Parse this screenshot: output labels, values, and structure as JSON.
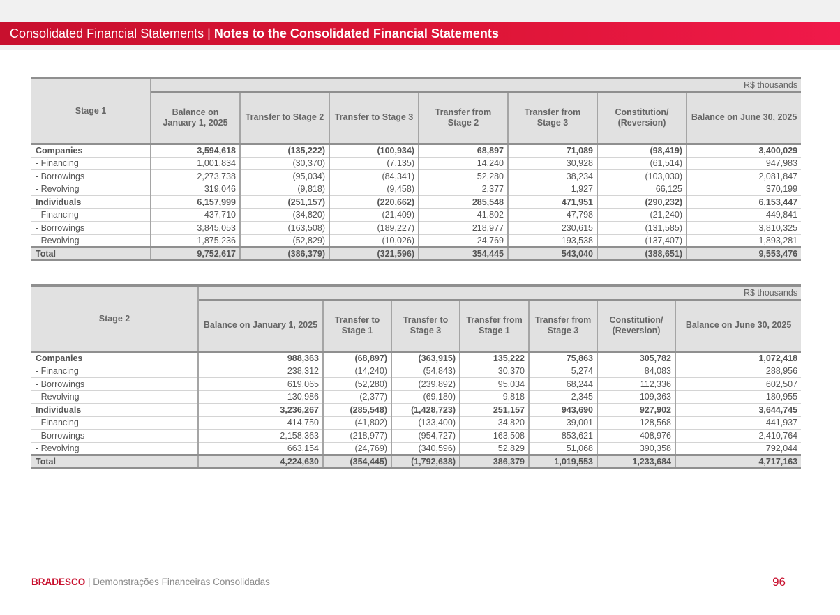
{
  "header": {
    "section": "Consolidated Financial Statements",
    "separator": " | ",
    "subsection": "Notes to the Consolidated Financial Statements"
  },
  "table1": {
    "corner": "Stage 1",
    "unit": "R$ thousands",
    "columns": [
      "Balance on January 1, 2025",
      "Transfer to Stage 2",
      "Transfer to Stage 3",
      "Transfer from Stage 2",
      "Transfer from Stage 3",
      "Constitution/ (Reversion)",
      "Balance on June 30, 2025"
    ],
    "rows": [
      {
        "label": "Companies",
        "values": [
          "3,594,618",
          "(135,222)",
          "(100,934)",
          "68,897",
          "71,089",
          "(98,419)",
          "3,400,029"
        ]
      },
      {
        "label": "- Financing",
        "values": [
          "1,001,834",
          "(30,370)",
          "(7,135)",
          "14,240",
          "30,928",
          "(61,514)",
          "947,983"
        ]
      },
      {
        "label": "- Borrowings",
        "values": [
          "2,273,738",
          "(95,034)",
          "(84,341)",
          "52,280",
          "38,234",
          "(103,030)",
          "2,081,847"
        ]
      },
      {
        "label": "- Revolving",
        "values": [
          "319,046",
          "(9,818)",
          "(9,458)",
          "2,377",
          "1,927",
          "66,125",
          "370,199"
        ]
      },
      {
        "label": "Individuals",
        "values": [
          "6,157,999",
          "(251,157)",
          "(220,662)",
          "285,548",
          "471,951",
          "(290,232)",
          "6,153,447"
        ]
      },
      {
        "label": "- Financing",
        "values": [
          "437,710",
          "(34,820)",
          "(21,409)",
          "41,802",
          "47,798",
          "(21,240)",
          "449,841"
        ]
      },
      {
        "label": "- Borrowings",
        "values": [
          "3,845,053",
          "(163,508)",
          "(189,227)",
          "218,977",
          "230,615",
          "(131,585)",
          "3,810,325"
        ]
      },
      {
        "label": "- Revolving",
        "values": [
          "1,875,236",
          "(52,829)",
          "(10,026)",
          "24,769",
          "193,538",
          "(137,407)",
          "1,893,281"
        ]
      }
    ],
    "total": {
      "label": "Total",
      "values": [
        "9,752,617",
        "(386,379)",
        "(321,596)",
        "354,445",
        "543,040",
        "(388,651)",
        "9,553,476"
      ]
    }
  },
  "table2": {
    "corner": "Stage 2",
    "unit": "R$ thousands",
    "columns": [
      "Balance on January 1, 2025",
      "Transfer to Stage 1",
      "Transfer to Stage 3",
      "Transfer from Stage 1",
      "Transfer from Stage 3",
      "Constitution/ (Reversion)",
      "Balance on June 30, 2025"
    ],
    "rows": [
      {
        "label": "Companies",
        "values": [
          "988,363",
          "(68,897)",
          "(363,915)",
          "135,222",
          "75,863",
          "305,782",
          "1,072,418"
        ]
      },
      {
        "label": "- Financing",
        "values": [
          "238,312",
          "(14,240)",
          "(54,843)",
          "30,370",
          "5,274",
          "84,083",
          "288,956"
        ]
      },
      {
        "label": "- Borrowings",
        "values": [
          "619,065",
          "(52,280)",
          "(239,892)",
          "95,034",
          "68,244",
          "112,336",
          "602,507"
        ]
      },
      {
        "label": "- Revolving",
        "values": [
          "130,986",
          "(2,377)",
          "(69,180)",
          "9,818",
          "2,345",
          "109,363",
          "180,955"
        ]
      },
      {
        "label": "Individuals",
        "values": [
          "3,236,267",
          "(285,548)",
          "(1,428,723)",
          "251,157",
          "943,690",
          "927,902",
          "3,644,745"
        ]
      },
      {
        "label": "- Financing",
        "values": [
          "414,750",
          "(41,802)",
          "(133,400)",
          "34,820",
          "39,001",
          "128,568",
          "441,937"
        ]
      },
      {
        "label": "- Borrowings",
        "values": [
          "2,158,363",
          "(218,977)",
          "(954,727)",
          "163,508",
          "853,621",
          "408,976",
          "2,410,764"
        ]
      },
      {
        "label": "- Revolving",
        "values": [
          "663,154",
          "(24,769)",
          "(340,596)",
          "52,829",
          "51,068",
          "390,358",
          "792,044"
        ]
      }
    ],
    "total": {
      "label": "Total",
      "values": [
        "4,224,630",
        "(354,445)",
        "(1,792,638)",
        "386,379",
        "1,019,553",
        "1,233,684",
        "4,717,163"
      ]
    }
  },
  "footer": {
    "brand": "BRADESCO",
    "separator": " | ",
    "text": "Demonstrações Financeiras Consolidadas",
    "page_number": "96"
  },
  "colors": {
    "brand_red": "#c8102e",
    "header_gradient_end": "#f0194a",
    "table_header_bg": "#e1e1e1"
  }
}
